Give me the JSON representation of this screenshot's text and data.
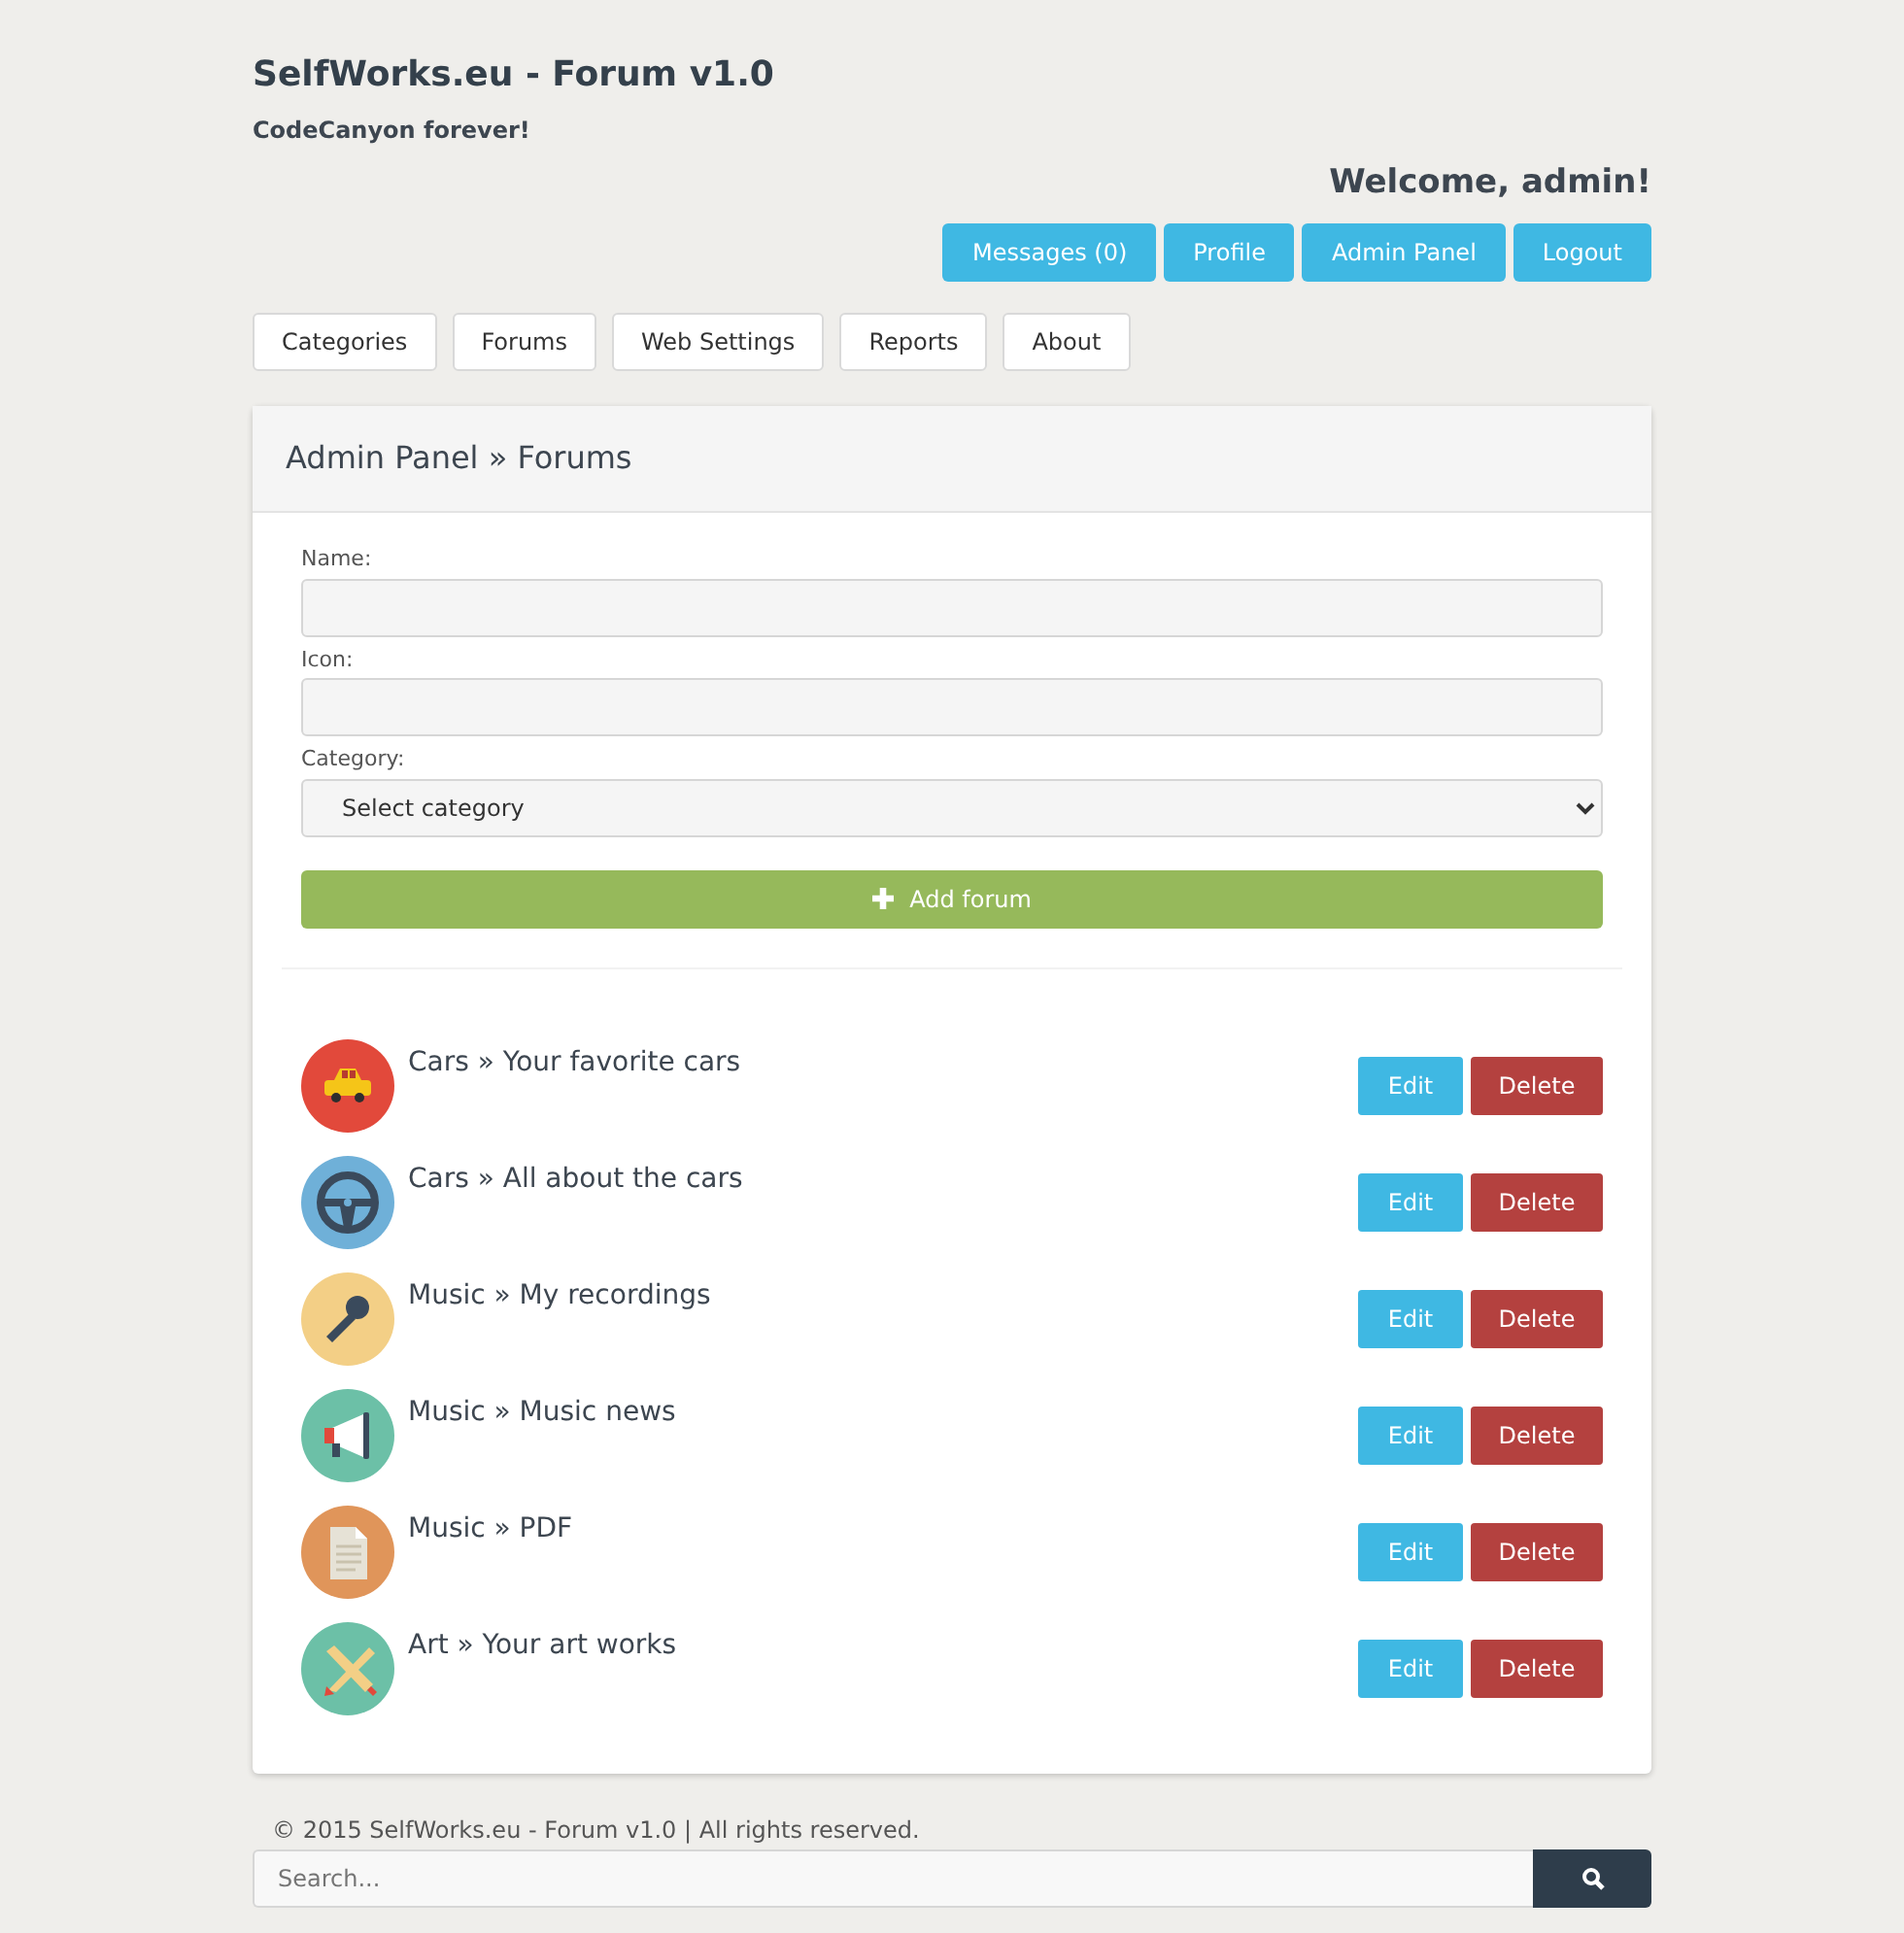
{
  "site": {
    "title": "SelfWorks.eu - Forum v1.0",
    "tagline": "CodeCanyon forever!",
    "welcome": "Welcome, admin!"
  },
  "user_buttons": [
    "Messages (0)",
    "Profile",
    "Admin Panel",
    "Logout"
  ],
  "nav": [
    "Categories",
    "Forums",
    "Web Settings",
    "Reports",
    "About"
  ],
  "panel": {
    "title": "Admin Panel » Forums",
    "form": {
      "fields": [
        {
          "kind": "text",
          "label": "Name:"
        },
        {
          "kind": "text",
          "label": "Icon:"
        },
        {
          "kind": "select",
          "label": "Category:",
          "value": "Select category"
        }
      ],
      "submit": "Add forum"
    },
    "forums": [
      {
        "kind": "car",
        "color": "#e2493b",
        "title": "Cars » Your favorite cars",
        "edit": "Edit",
        "delete": "Delete"
      },
      {
        "kind": "wheel",
        "color": "#6fb0d8",
        "title": "Cars » All about the cars",
        "edit": "Edit",
        "delete": "Delete"
      },
      {
        "kind": "mic",
        "color": "#f3cf86",
        "title": "Music » My recordings",
        "edit": "Edit",
        "delete": "Delete"
      },
      {
        "kind": "megaphone",
        "color": "#6cc0a7",
        "title": "Music » Music news",
        "edit": "Edit",
        "delete": "Delete"
      },
      {
        "kind": "document",
        "color": "#e0955a",
        "title": "Music » PDF",
        "edit": "Edit",
        "delete": "Delete"
      },
      {
        "kind": "pencils",
        "color": "#6cc0a7",
        "title": "Art » Your art works",
        "edit": "Edit",
        "delete": "Delete"
      }
    ]
  },
  "footer": {
    "copyright": "© 2015 SelfWorks.eu - Forum v1.0 | All rights reserved.",
    "search_placeholder": "Search..."
  }
}
